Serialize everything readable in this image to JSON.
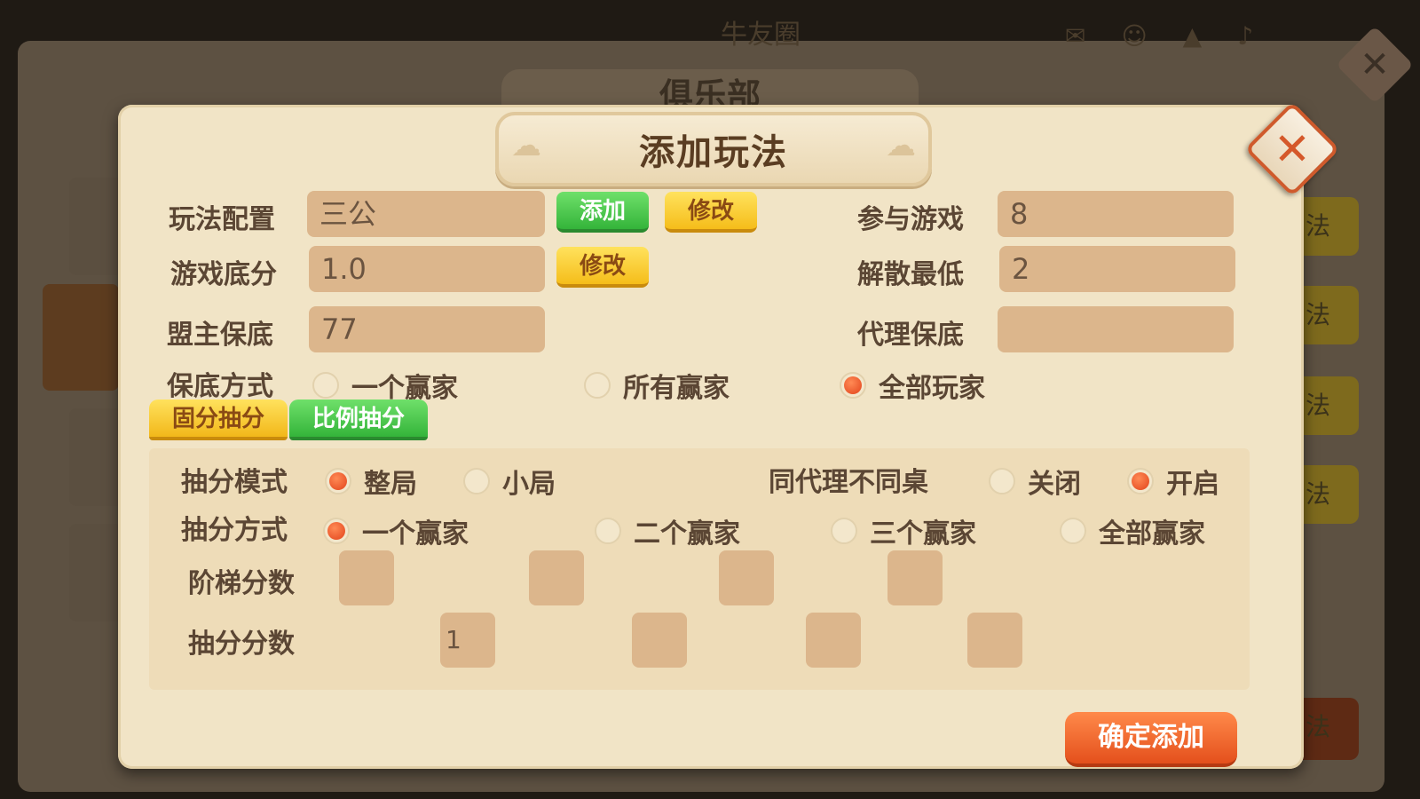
{
  "background": {
    "top_title": "牛友圈",
    "panel_title": "俱乐部",
    "side_button_text": "法"
  },
  "dialog": {
    "title": "添加玩法",
    "close_glyph": "✕",
    "rows": {
      "play_config": {
        "label": "玩法配置",
        "value": "三公",
        "add_btn": "添加",
        "edit_btn": "修改"
      },
      "base_score": {
        "label": "游戏底分",
        "value": "1.0",
        "edit_btn": "修改"
      },
      "leader_floor": {
        "label": "盟主保底",
        "value": "77"
      },
      "join_game": {
        "label": "参与游戏",
        "value": "8"
      },
      "dissolve_min": {
        "label": "解散最低",
        "value": "2"
      },
      "agent_floor": {
        "label": "代理保底",
        "value": ""
      }
    },
    "floor_mode": {
      "label": "保底方式",
      "options": [
        {
          "text": "一个赢家",
          "selected": false
        },
        {
          "text": "所有赢家",
          "selected": false
        },
        {
          "text": "全部玩家",
          "selected": true
        }
      ]
    },
    "tabs": {
      "fixed": "固分抽分",
      "ratio": "比例抽分"
    },
    "draw_mode": {
      "label": "抽分模式",
      "options": [
        {
          "text": "整局",
          "selected": true
        },
        {
          "text": "小局",
          "selected": false
        }
      ]
    },
    "same_agent": {
      "label": "同代理不同桌",
      "options": [
        {
          "text": "关闭",
          "selected": false
        },
        {
          "text": "开启",
          "selected": true
        }
      ]
    },
    "draw_method": {
      "label": "抽分方式",
      "options": [
        {
          "text": "一个赢家",
          "selected": true
        },
        {
          "text": "二个赢家",
          "selected": false
        },
        {
          "text": "三个赢家",
          "selected": false
        },
        {
          "text": "全部赢家",
          "selected": false
        }
      ]
    },
    "ladder_scores": {
      "label": "阶梯分数",
      "values": [
        "",
        "",
        "",
        ""
      ]
    },
    "draw_scores": {
      "label": "抽分分数",
      "values": [
        "1",
        "",
        "",
        ""
      ]
    },
    "confirm_button": "确定添加"
  },
  "colors": {
    "dialog_bg": "#f1e4c6",
    "field_bg": "#dcb68c",
    "green_button": "#34b43a",
    "yellow_button": "#f5bd1a",
    "confirm_button": "#e4501c",
    "radio_selected": "#e2431b"
  }
}
